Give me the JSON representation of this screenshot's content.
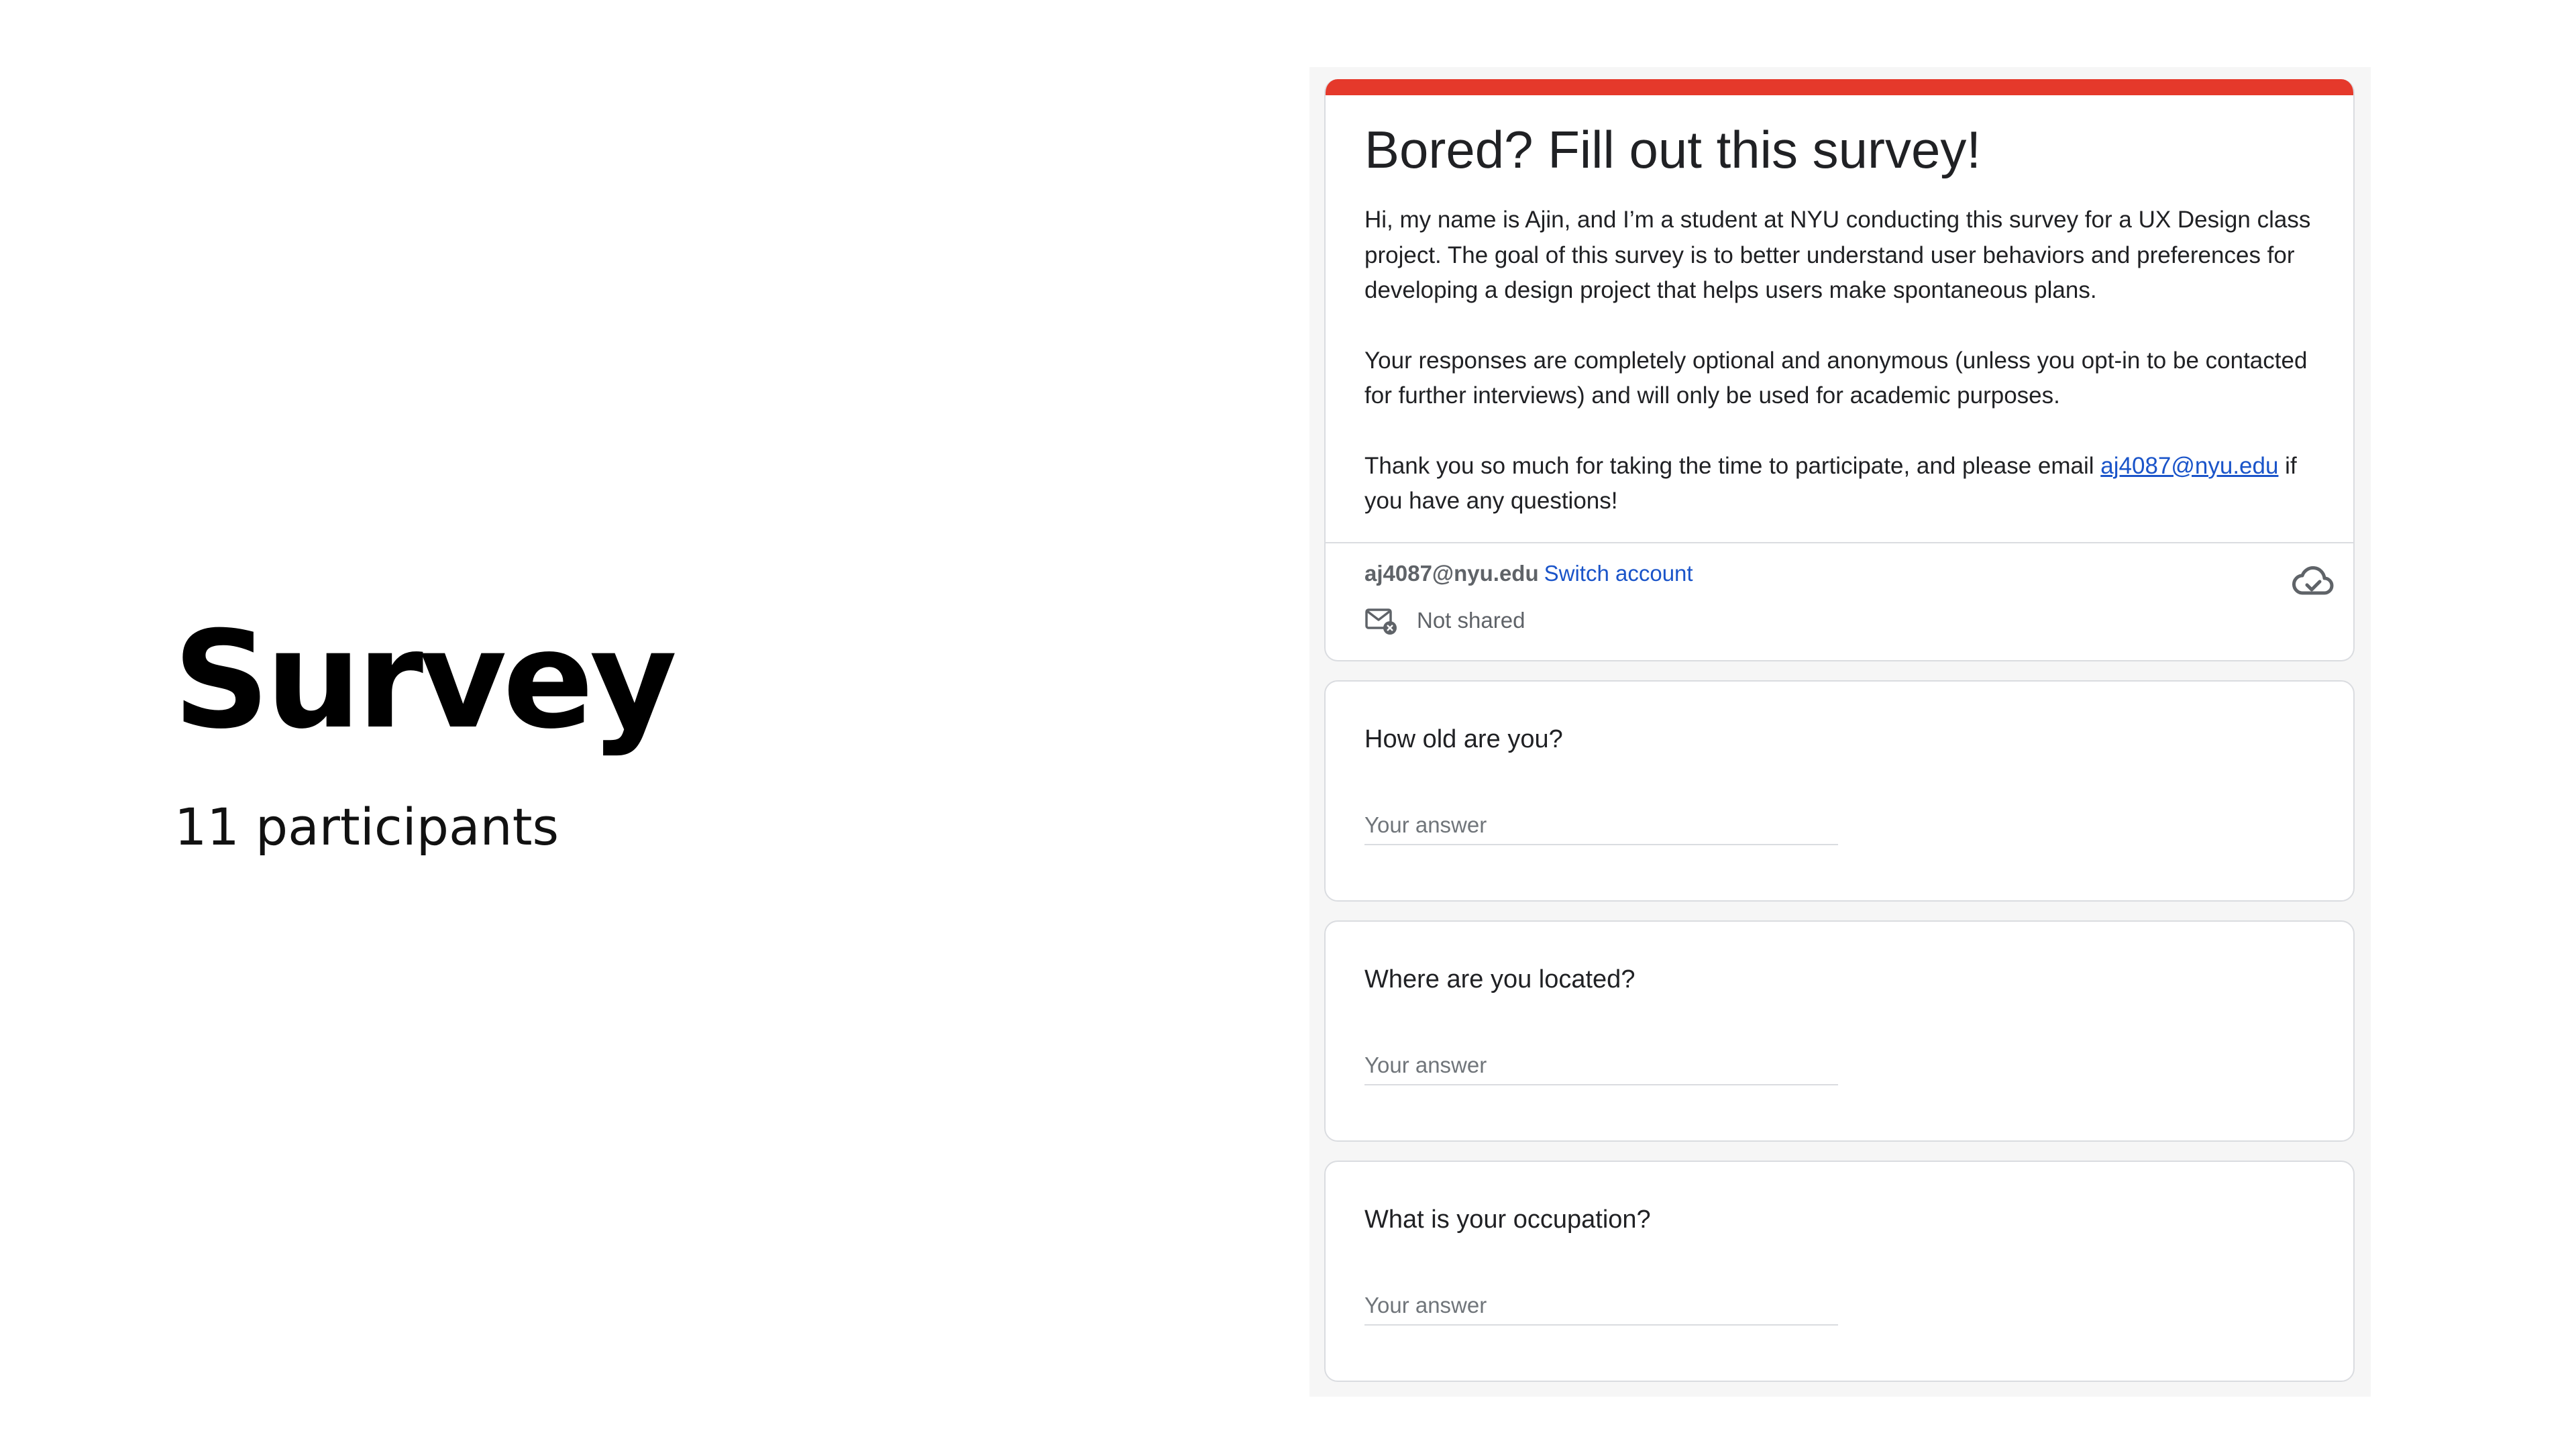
{
  "slide": {
    "title": "Survey",
    "subtitle": "11 participants"
  },
  "form": {
    "accent_color": "#e5392b",
    "link_color": "#1a54c9",
    "title": "Bored? Fill out this survey!",
    "description": {
      "paragraph1": "Hi, my name is Ajin, and I’m a student at NYU conducting this survey for a UX Design class project. The goal of this survey is to better understand user behaviors and preferences for developing a design project that helps users make spontaneous plans.",
      "paragraph2": "Your responses are completely optional and anonymous (unless you opt-in to be contacted for further interviews) and will only be used for academic purposes.",
      "paragraph3_before": "Thank you so much for taking the time to participate, and please email ",
      "paragraph3_link": "aj4087@nyu.edu",
      "paragraph3_after": " if you have any questions!"
    },
    "account": {
      "email": "aj4087@nyu.edu",
      "switch_label": "Switch account",
      "sharing_status": "Not shared",
      "sharing_icon": "mail-off-icon",
      "save_icon": "cloud-check-icon"
    },
    "questions": [
      {
        "text": "How old are you?",
        "placeholder": "Your answer"
      },
      {
        "text": "Where are you located?",
        "placeholder": "Your answer"
      },
      {
        "text": "What is your occupation?",
        "placeholder": "Your answer"
      }
    ]
  }
}
